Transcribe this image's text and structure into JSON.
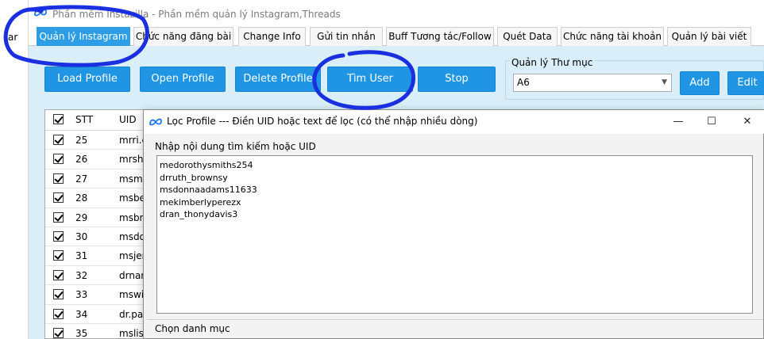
{
  "left_strip": {
    "text": "ar"
  },
  "app": {
    "title": "Phần mềm Instazilla - Phần mềm quản lý Instagram,Threads"
  },
  "tabs": [
    {
      "label": "Quản lý Instagram",
      "active": true
    },
    {
      "label": "Chức năng đăng bài",
      "active": false
    },
    {
      "label": "Change Info",
      "active": false
    },
    {
      "label": "Gửi tin nhắn",
      "active": false
    },
    {
      "label": "Buff Tương tác/Follow",
      "active": false
    },
    {
      "label": "Quét Data",
      "active": false
    },
    {
      "label": "Chức năng tài khoản",
      "active": false
    },
    {
      "label": "Quản lý bài viết",
      "active": false
    }
  ],
  "toolbar": {
    "load_profile": "Load Profile",
    "open_profile": "Open Profile",
    "delete_profile": "Delete Profile",
    "find_user": "Tìm User",
    "stop": "Stop"
  },
  "folder": {
    "label": "Quản lý Thư mục",
    "selected": "A6",
    "add": "Add",
    "edit": "Edit"
  },
  "table": {
    "headers": {
      "stt": "STT",
      "uid": "UID"
    },
    "rows": [
      {
        "stt": "25",
        "uid": "mrri.c"
      },
      {
        "stt": "26",
        "uid": "mrshe"
      },
      {
        "stt": "27",
        "uid": "msmi"
      },
      {
        "stt": "28",
        "uid": "msbe"
      },
      {
        "stt": "29",
        "uid": "msbri"
      },
      {
        "stt": "30",
        "uid": "msdo"
      },
      {
        "stt": "31",
        "uid": "msjen"
      },
      {
        "stt": "32",
        "uid": "drnan"
      },
      {
        "stt": "33",
        "uid": "mswil"
      },
      {
        "stt": "34",
        "uid": "dr.pau"
      },
      {
        "stt": "35",
        "uid": "mslisa"
      }
    ]
  },
  "dialog": {
    "title": "Lọc Profile --- Điền UID hoặc text để lọc (có thể nhập nhiều dòng)",
    "minimize": "—",
    "maximize": "☐",
    "close": "✕",
    "group_label": "Nhập nội dung tìm kiếm hoặc UID",
    "lines": [
      "medorothysmiths254",
      "drruth_brownsy",
      "msdonnaadams11633",
      "mekimberlyperezx",
      "dran_thonydavis3"
    ],
    "category_label": "Chọn danh mục"
  },
  "colors": {
    "accent": "#1f95e3",
    "active_tab": "#2d9ee6",
    "content_bg": "#d9eef8",
    "annotation_ink": "#1a2fe0"
  }
}
